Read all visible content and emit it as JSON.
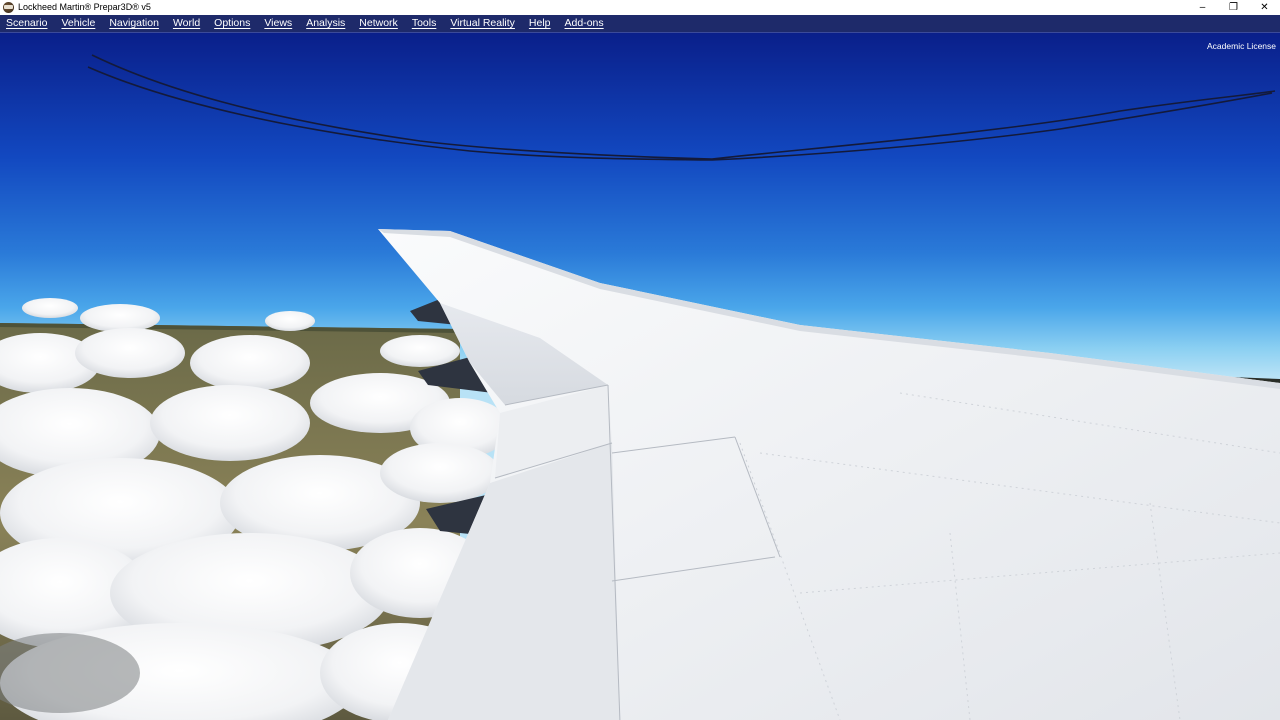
{
  "window": {
    "title": "Lockheed Martin® Prepar3D® v5",
    "controls": {
      "minimize": "–",
      "restore": "❐",
      "close": "✕"
    }
  },
  "menubar": {
    "items": [
      {
        "label": "Scenario"
      },
      {
        "label": "Vehicle"
      },
      {
        "label": "Navigation"
      },
      {
        "label": "World"
      },
      {
        "label": "Options"
      },
      {
        "label": "Views"
      },
      {
        "label": "Analysis"
      },
      {
        "label": "Network"
      },
      {
        "label": "Tools"
      },
      {
        "label": "Virtual Reality"
      },
      {
        "label": "Help"
      },
      {
        "label": "Add-ons"
      }
    ],
    "background": "#1e2a6a"
  },
  "viewport": {
    "license_text": "Academic License",
    "sky_top_color": "#0a1f8a",
    "sky_mid_color": "#2a7ad8",
    "horizon_color": "#8cd0f2",
    "wing_color": "#f2f4f6"
  }
}
